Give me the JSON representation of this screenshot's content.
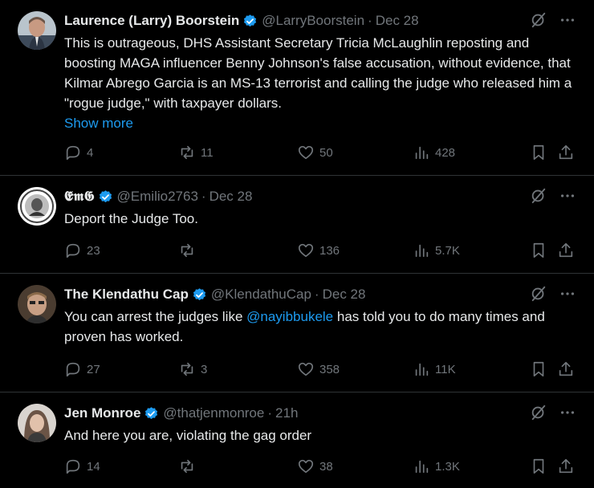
{
  "tweets": [
    {
      "name": "Laurence (Larry) Boorstein",
      "handle": "@LarryBoorstein",
      "sep": "·",
      "time": "Dec 28",
      "text": "This is outrageous,  DHS Assistant Secretary Tricia McLaughlin reposting and boosting MAGA influencer Benny Johnson's false accusation, without evidence, that Kilmar Abrego Garcia is an MS-13 terrorist and calling the judge who released him a \"rogue judge,\" with taxpayer dollars.",
      "show_more": "Show more",
      "replies": "4",
      "reposts": "11",
      "likes": "50",
      "views": "428"
    },
    {
      "name": "𝕰𝖒𝕲",
      "handle": "@Emilio2763",
      "sep": "·",
      "time": "Dec 28",
      "text": "Deport the Judge Too.",
      "replies": "23",
      "reposts": "",
      "likes": "136",
      "views": "5.7K"
    },
    {
      "name": "The Klendathu Cap",
      "handle": "@KlendathuCap",
      "sep": "·",
      "time": "Dec 28",
      "text_before": "You can arrest the judges like ",
      "mention": "@nayibbukele",
      "text_after": " has told you to do many times and proven has worked.",
      "replies": "27",
      "reposts": "3",
      "likes": "358",
      "views": "11K"
    },
    {
      "name": "Jen Monroe",
      "handle": "@thatjenmonroe",
      "sep": "·",
      "time": "21h",
      "text": "And here you are, violating the gag order",
      "replies": "14",
      "reposts": "",
      "likes": "38",
      "views": "1.3K"
    }
  ],
  "colors": {
    "background": "#000000",
    "text": "#e7e9ea",
    "muted": "#71767b",
    "accent": "#1d9bf0",
    "divider": "#2f3336"
  },
  "icons": [
    "grok-icon",
    "more-icon",
    "verified-icon",
    "reply-icon",
    "repost-icon",
    "like-icon",
    "views-icon",
    "bookmark-icon",
    "share-icon"
  ]
}
